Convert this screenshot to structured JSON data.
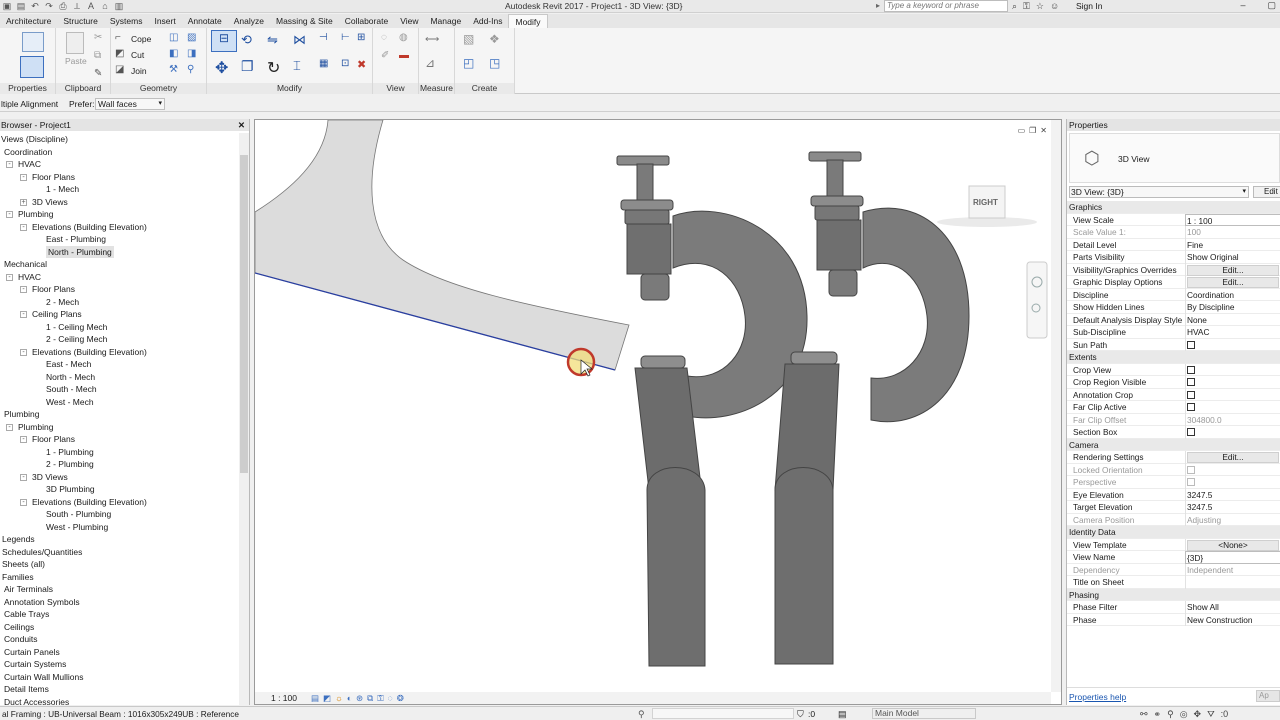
{
  "titlebar": {
    "title": "Autodesk Revit 2017 -     Project1 - 3D View: {3D}",
    "search_placeholder": "Type a keyword or phrase",
    "signin": "Sign In"
  },
  "tabs": [
    "Architecture",
    "Structure",
    "Systems",
    "Insert",
    "Annotate",
    "Analyze",
    "Massing & Site",
    "Collaborate",
    "View",
    "Manage",
    "Add-Ins",
    "Modify"
  ],
  "active_tab": "Modify",
  "ribbon": {
    "panels": [
      "Properties",
      "Clipboard",
      "Geometry",
      "Modify",
      "View",
      "Measure",
      "Create"
    ],
    "paste": "Paste",
    "cope": "Cope",
    "cut": "Cut",
    "join": "Join"
  },
  "optbar": {
    "label": "ltiple Alignment",
    "prefer_label": "Prefer:",
    "prefer_value": "Wall faces"
  },
  "browser": {
    "title": "Browser - Project1",
    "items": [
      {
        "label": "Views (Discipline)"
      },
      {
        "label": "Coordination"
      },
      {
        "label": "HVAC"
      },
      {
        "label": "Floor Plans"
      },
      {
        "label": "1 - Mech"
      },
      {
        "label": "3D Views"
      },
      {
        "label": "Plumbing"
      },
      {
        "label": "Elevations (Building Elevation)"
      },
      {
        "label": "East - Plumbing"
      },
      {
        "label": "North - Plumbing"
      },
      {
        "label": "Mechanical"
      },
      {
        "label": "HVAC"
      },
      {
        "label": "Floor Plans"
      },
      {
        "label": "2 - Mech"
      },
      {
        "label": "Ceiling Plans"
      },
      {
        "label": "1 - Ceiling Mech"
      },
      {
        "label": "2 - Ceiling Mech"
      },
      {
        "label": "Elevations (Building Elevation)"
      },
      {
        "label": "East - Mech"
      },
      {
        "label": "North - Mech"
      },
      {
        "label": "South - Mech"
      },
      {
        "label": "West - Mech"
      },
      {
        "label": "Plumbing"
      },
      {
        "label": "Plumbing"
      },
      {
        "label": "Floor Plans"
      },
      {
        "label": "1 - Plumbing"
      },
      {
        "label": "2 - Plumbing"
      },
      {
        "label": "3D Views"
      },
      {
        "label": "3D Plumbing"
      },
      {
        "label": "Elevations (Building Elevation)"
      },
      {
        "label": "South - Plumbing"
      },
      {
        "label": "West - Plumbing"
      },
      {
        "label": "Legends"
      },
      {
        "label": "Schedules/Quantities"
      },
      {
        "label": "Sheets (all)"
      },
      {
        "label": "Families"
      },
      {
        "label": "Air Terminals"
      },
      {
        "label": "Annotation Symbols"
      },
      {
        "label": "Cable Trays"
      },
      {
        "label": "Ceilings"
      },
      {
        "label": "Conduits"
      },
      {
        "label": "Curtain Panels"
      },
      {
        "label": "Curtain Systems"
      },
      {
        "label": "Curtain Wall Mullions"
      },
      {
        "label": "Detail Items"
      },
      {
        "label": "Duct Accessories"
      }
    ]
  },
  "viewport": {
    "viewcube_label": "RIGHT",
    "scale": "1 : 100"
  },
  "properties": {
    "title": "Properties",
    "type_name": "3D View",
    "type_selector": "3D View: {3D}",
    "edit_type": "Edit",
    "rows": [
      {
        "k": "Graphics",
        "cat": true
      },
      {
        "k": "View Scale",
        "v": "1 : 100",
        "boxed": true
      },
      {
        "k": "Scale Value    1:",
        "v": "100",
        "dim": true
      },
      {
        "k": "Detail Level",
        "v": "Fine"
      },
      {
        "k": "Parts Visibility",
        "v": "Show Original"
      },
      {
        "k": "Visibility/Graphics Overrides",
        "v": "Edit...",
        "btn": true
      },
      {
        "k": "Graphic Display Options",
        "v": "Edit...",
        "btn": true
      },
      {
        "k": "Discipline",
        "v": "Coordination"
      },
      {
        "k": "Show Hidden Lines",
        "v": "By Discipline"
      },
      {
        "k": "Default Analysis Display Style",
        "v": "None"
      },
      {
        "k": "Sub-Discipline",
        "v": "HVAC"
      },
      {
        "k": "Sun Path",
        "cb": true
      },
      {
        "k": "Extents",
        "cat": true
      },
      {
        "k": "Crop View",
        "cb": true
      },
      {
        "k": "Crop Region Visible",
        "cb": true
      },
      {
        "k": "Annotation Crop",
        "cb": true
      },
      {
        "k": "Far Clip Active",
        "cb": true
      },
      {
        "k": "Far Clip Offset",
        "v": "304800.0",
        "dim": true
      },
      {
        "k": "Section Box",
        "cb": true
      },
      {
        "k": "Camera",
        "cat": true
      },
      {
        "k": "Rendering Settings",
        "v": "Edit...",
        "btn": true
      },
      {
        "k": "Locked Orientation",
        "cb": true,
        "dim": true
      },
      {
        "k": "Perspective",
        "cb": true,
        "dim": true
      },
      {
        "k": "Eye Elevation",
        "v": "3247.5"
      },
      {
        "k": "Target Elevation",
        "v": "3247.5"
      },
      {
        "k": "Camera Position",
        "v": "Adjusting",
        "dim": true
      },
      {
        "k": "Identity Data",
        "cat": true
      },
      {
        "k": "View Template",
        "v": "<None>",
        "btn": true
      },
      {
        "k": "View Name",
        "v": "{3D}",
        "boxed": true
      },
      {
        "k": "Dependency",
        "v": "Independent",
        "dim": true
      },
      {
        "k": "Title on Sheet",
        "v": ""
      },
      {
        "k": "Phasing",
        "cat": true
      },
      {
        "k": "Phase Filter",
        "v": "Show All"
      },
      {
        "k": "Phase",
        "v": "New Construction"
      }
    ],
    "help_link": "Properties help",
    "apply": "Ap"
  },
  "status": {
    "message": "al Framing : UB-Universal Beam : 1016x305x249UB : Reference",
    "zero": ":0",
    "model": "Main Model"
  }
}
